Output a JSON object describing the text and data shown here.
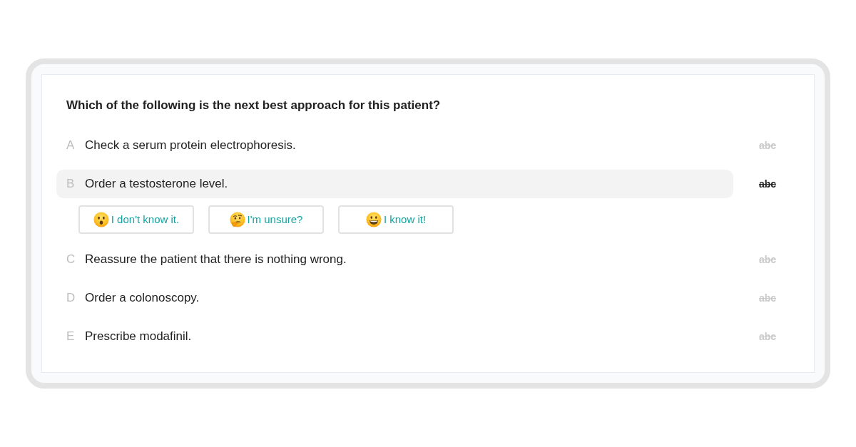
{
  "question": "Which of the following is the next best approach for this patient?",
  "options": [
    {
      "letter": "A",
      "text": "Check a serum protein electrophoresis.",
      "strike_label": "abc",
      "highlighted": false
    },
    {
      "letter": "B",
      "text": "Order a testosterone level.",
      "strike_label": "abc",
      "highlighted": true,
      "confidence_buttons": [
        {
          "kind": "dont_know",
          "label": "I don't know it."
        },
        {
          "kind": "unsure",
          "label": "I'm unsure?"
        },
        {
          "kind": "know",
          "label": "I know it!"
        }
      ]
    },
    {
      "letter": "C",
      "text": "Reassure the patient that there is nothing wrong.",
      "strike_label": "abc",
      "highlighted": false
    },
    {
      "letter": "D",
      "text": "Order a colonoscopy.",
      "strike_label": "abc",
      "highlighted": false
    },
    {
      "letter": "E",
      "text": "Prescribe modafinil.",
      "strike_label": "abc",
      "highlighted": false
    }
  ]
}
